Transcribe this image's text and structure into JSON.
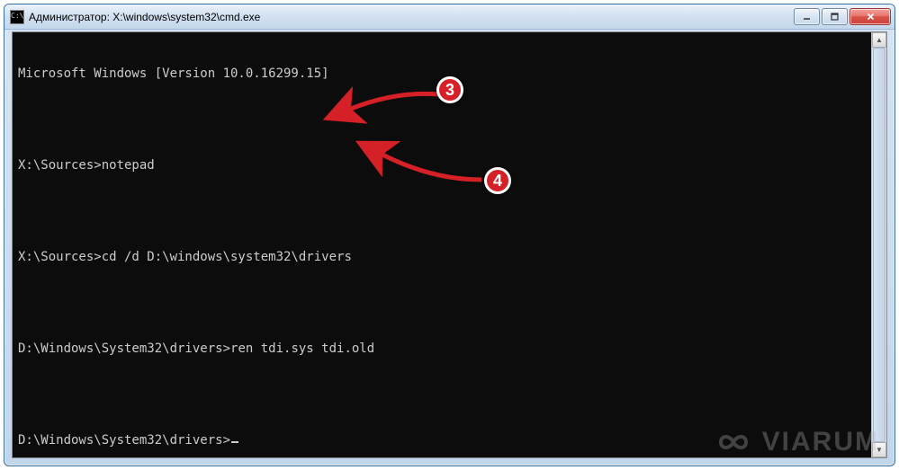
{
  "window": {
    "title": "Администратор: X:\\windows\\system32\\cmd.exe",
    "icon_label": "C:\\"
  },
  "terminal": {
    "lines": [
      {
        "prompt": "",
        "text": "Microsoft Windows [Version 10.0.16299.15]"
      },
      {
        "prompt": "",
        "text": ""
      },
      {
        "prompt": "X:\\Sources>",
        "text": "notepad"
      },
      {
        "prompt": "",
        "text": ""
      },
      {
        "prompt": "X:\\Sources>",
        "text": "cd /d D:\\windows\\system32\\drivers"
      },
      {
        "prompt": "",
        "text": ""
      },
      {
        "prompt": "D:\\Windows\\System32\\drivers>",
        "text": "ren tdi.sys tdi.old"
      },
      {
        "prompt": "",
        "text": ""
      },
      {
        "prompt": "D:\\Windows\\System32\\drivers>",
        "text": ""
      }
    ]
  },
  "callouts": [
    {
      "label": "3"
    },
    {
      "label": "4"
    }
  ],
  "watermark": {
    "text": "VIARUM"
  }
}
